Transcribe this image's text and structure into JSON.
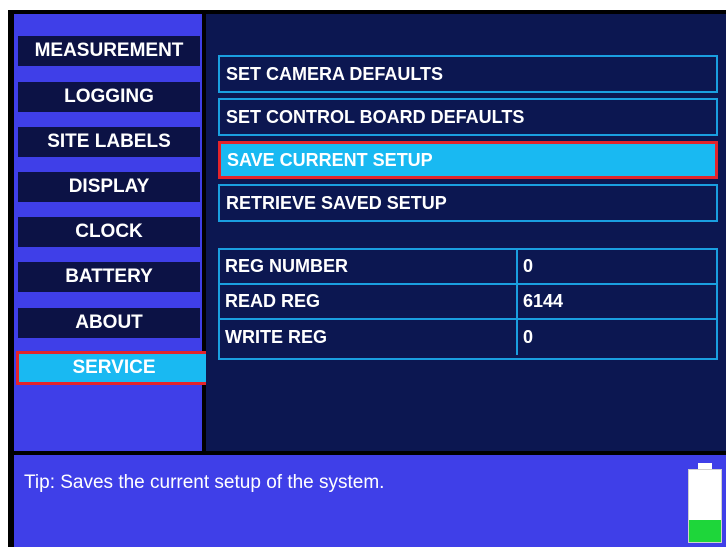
{
  "sidebar": {
    "items": [
      {
        "label": "MEASUREMENT",
        "active": false
      },
      {
        "label": "LOGGING",
        "active": false
      },
      {
        "label": "SITE LABELS",
        "active": false
      },
      {
        "label": "DISPLAY",
        "active": false
      },
      {
        "label": "CLOCK",
        "active": false
      },
      {
        "label": "BATTERY",
        "active": false
      },
      {
        "label": "ABOUT",
        "active": false
      },
      {
        "label": "SERVICE",
        "active": true
      }
    ]
  },
  "service_menu": {
    "items": [
      {
        "label": "SET CAMERA DEFAULTS",
        "selected": false
      },
      {
        "label": "SET CONTROL BOARD DEFAULTS",
        "selected": false
      },
      {
        "label": "SAVE CURRENT SETUP",
        "selected": true
      },
      {
        "label": "RETRIEVE SAVED SETUP",
        "selected": false
      }
    ]
  },
  "registers": [
    {
      "name": "REG NUMBER",
      "value": "0"
    },
    {
      "name": "READ REG",
      "value": "6144"
    },
    {
      "name": "WRITE REG",
      "value": "0"
    }
  ],
  "tip": {
    "text": "Tip:  Saves the current setup of the system."
  },
  "battery": {
    "level_fraction": 0.3,
    "icon": "battery-icon"
  },
  "colors": {
    "sidebar_bg": "#3f3fe8",
    "button_bg": "#0c1245",
    "main_bg": "#0c1751",
    "highlight": "#19b9f2",
    "selection_border": "#e3242b",
    "grid_line": "#1a9fe0",
    "battery_fill": "#1ed63a"
  }
}
